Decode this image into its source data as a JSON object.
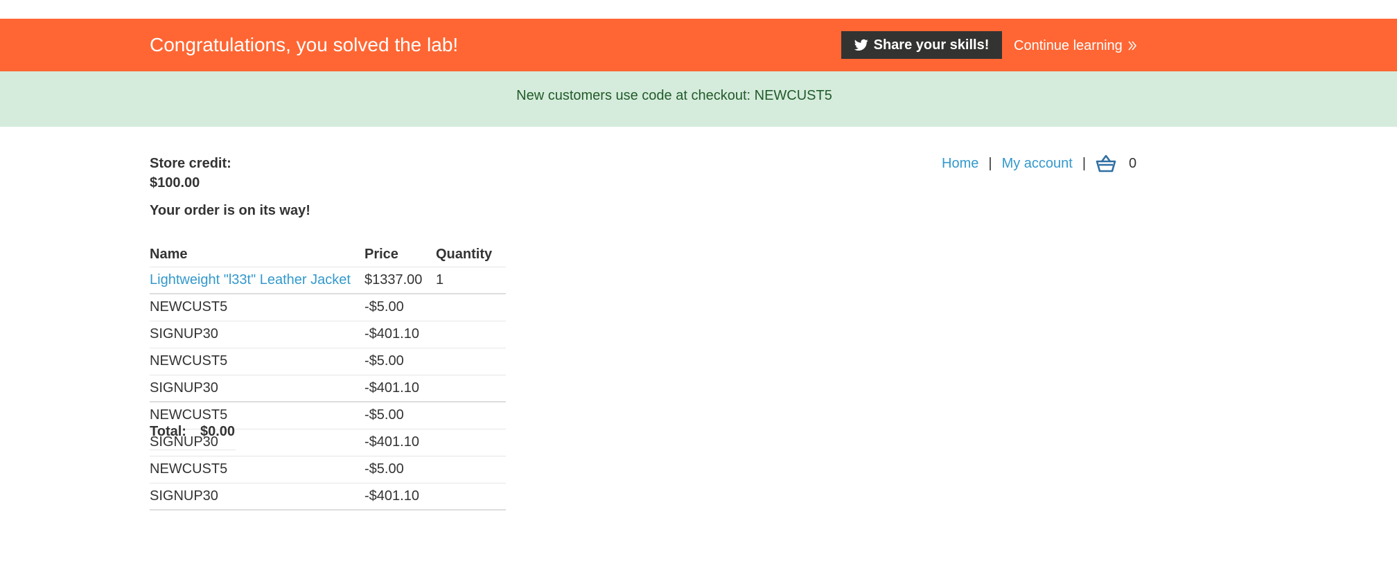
{
  "banner": {
    "title": "Congratulations, you solved the lab!",
    "share_label": "Share your skills!",
    "continue_label": "Continue learning",
    "color": "#ff6633"
  },
  "promo": {
    "text": "New customers use code at checkout: NEWCUST5",
    "color": "#d5ecdc"
  },
  "account": {
    "credit_label": "Store credit:",
    "credit_value": "$100.00",
    "order_message": "Your order is on its way!"
  },
  "nav": {
    "home": "Home",
    "separator": "|",
    "my_account": "My account",
    "cart_count": "0"
  },
  "table": {
    "headers": [
      "Name",
      "Price",
      "Quantity"
    ],
    "rows": [
      {
        "name": "Lightweight \"l33t\" Leather Jacket",
        "price": "$1337.00",
        "quantity": "1"
      },
      {
        "name": "NEWCUST5",
        "price": "-$5.00",
        "quantity": ""
      },
      {
        "name": "SIGNUP30",
        "price": "-$401.10",
        "quantity": ""
      },
      {
        "name": "NEWCUST5",
        "price": "-$5.00",
        "quantity": ""
      },
      {
        "name": "SIGNUP30",
        "price": "-$401.10",
        "quantity": ""
      },
      {
        "name": "NEWCUST5",
        "price": "-$5.00",
        "quantity": ""
      },
      {
        "name": "SIGNUP30",
        "price": "-$401.10",
        "quantity": ""
      },
      {
        "name": "NEWCUST5",
        "price": "-$5.00",
        "quantity": ""
      },
      {
        "name": "SIGNUP30",
        "price": "-$401.10",
        "quantity": ""
      }
    ]
  },
  "total": {
    "label": "Total:",
    "value": "$0.00"
  }
}
